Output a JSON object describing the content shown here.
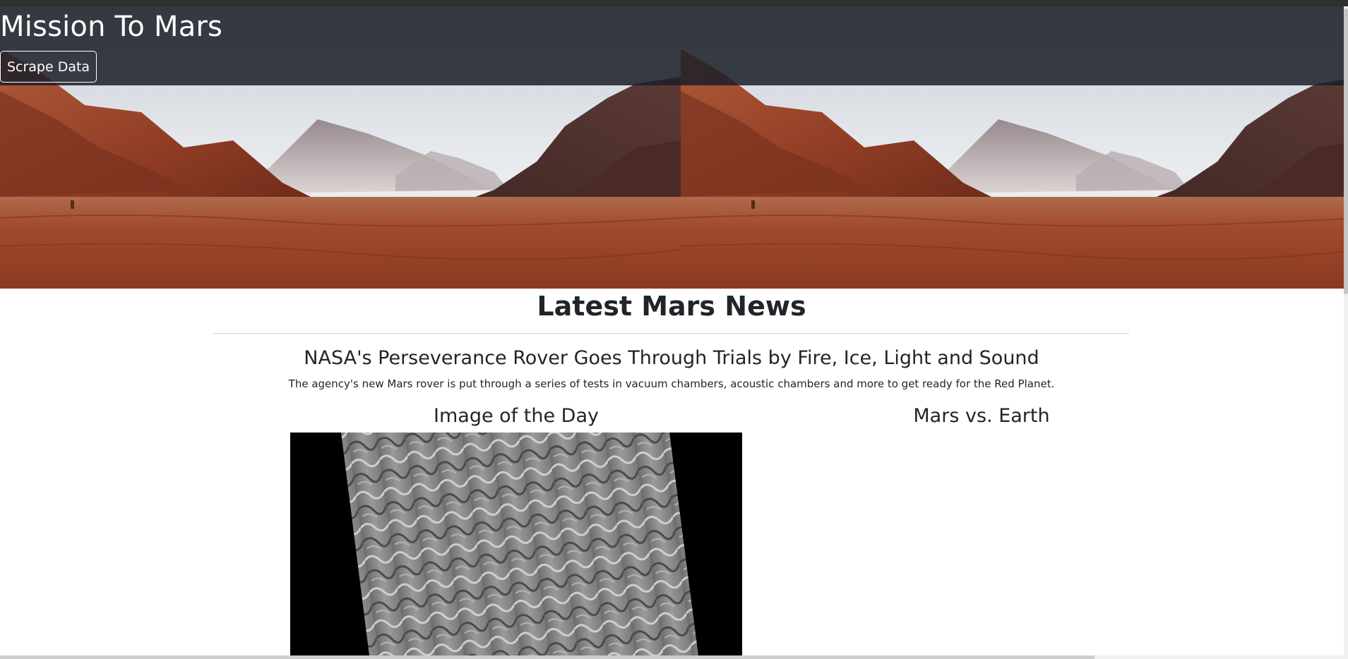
{
  "header": {
    "title": "Mission To Mars",
    "scrape_button_label": "Scrape Data"
  },
  "hero": {
    "image_description_icon": "mars-landscape-image"
  },
  "news": {
    "section_heading": "Latest Mars News",
    "headline": "NASA's Perseverance Rover Goes Through Trials by Fire, Ice, Light and Sound",
    "teaser": "The agency's new Mars rover is put through a series of tests in vacuum chambers, acoustic chambers and more to get ready for the Red Planet."
  },
  "sections": {
    "image_of_day_heading": "Image of the Day",
    "mars_vs_earth_heading": "Mars vs. Earth"
  },
  "colors": {
    "header_overlay": "#1c2028",
    "text_dark": "#212529",
    "mars_red": "#a8462a"
  }
}
